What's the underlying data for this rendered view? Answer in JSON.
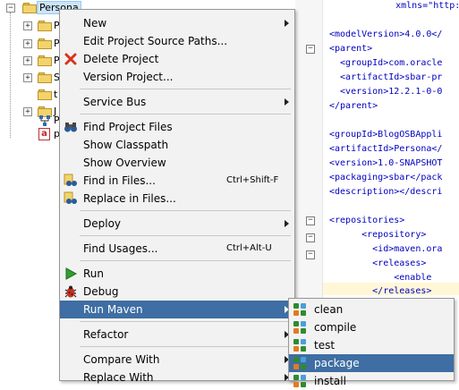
{
  "tree": {
    "rows": [
      {
        "label": "Persona"
      },
      {
        "label": "P"
      },
      {
        "label": "P"
      },
      {
        "label": "P"
      },
      {
        "label": "S"
      },
      {
        "label": "t"
      },
      {
        "label": "J"
      },
      {
        "label": "P"
      },
      {
        "label": "p"
      }
    ]
  },
  "menu": {
    "new": "New",
    "edit_paths": "Edit Project Source Paths...",
    "delete": "Delete Project",
    "version": "Version Project...",
    "service_bus": "Service Bus",
    "find_files": "Find Project Files",
    "show_classpath": "Show Classpath",
    "show_overview": "Show Overview",
    "find_in_files": "Find in Files...",
    "find_in_files_shortcut": "Ctrl+Shift-F",
    "replace_in_files": "Replace in Files...",
    "deploy": "Deploy",
    "find_usages": "Find Usages...",
    "find_usages_shortcut": "Ctrl+Alt-U",
    "run": "Run",
    "debug": "Debug",
    "run_maven": "Run Maven",
    "refactor": "Refactor",
    "compare_with": "Compare With",
    "replace_with": "Replace With"
  },
  "submenu": {
    "items": [
      "clean",
      "compile",
      "test",
      "package",
      "install"
    ]
  },
  "editor": {
    "lines": [
      "    xmlns=\"http://",
      "",
      "<modelVersion>4.0.0</",
      "<parent>",
      "  <groupId>com.oracle",
      "  <artifactId>sbar-pr",
      "  <version>12.2.1-0-0",
      "</parent>",
      "",
      "<groupId>BlogOSBAppli",
      "<artifactId>Persona</",
      "<version>1.0-SNAPSHOT",
      "<packaging>sbar</pack",
      "<description></descri",
      "",
      "<repositories>",
      "      <repository>",
      "        <id>maven.ora",
      "        <releases>",
      "            <enable",
      "        </releases>"
    ]
  },
  "colors": {
    "highlight": "#3e6ea3",
    "menu_bg": "#f2f2f2",
    "xml_tag": "#0000c0"
  }
}
